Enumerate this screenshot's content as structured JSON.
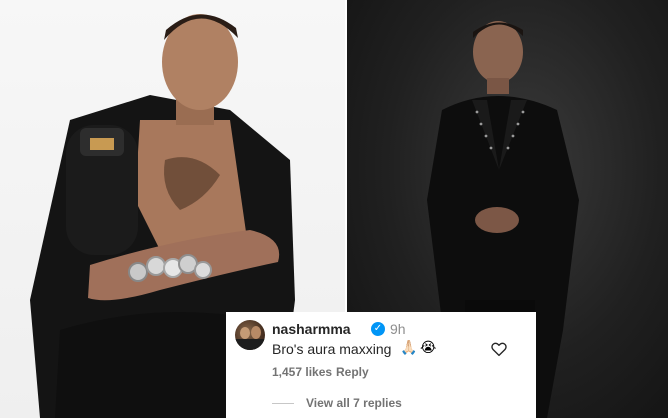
{
  "comment": {
    "username": "nasharmma",
    "verified": true,
    "timestamp": "9h",
    "text": "Bro's aura maxxing",
    "emojis": [
      "🙏🏻",
      "😭"
    ],
    "likes": "1,457 likes",
    "reply_label": "Reply",
    "view_replies": "View all 7 replies"
  },
  "icons": {
    "verified": "verified-badge-icon",
    "like": "heart-outline-icon"
  },
  "colors": {
    "verified_blue": "#0095f6",
    "text_primary": "#262626",
    "text_secondary": "#737373"
  }
}
